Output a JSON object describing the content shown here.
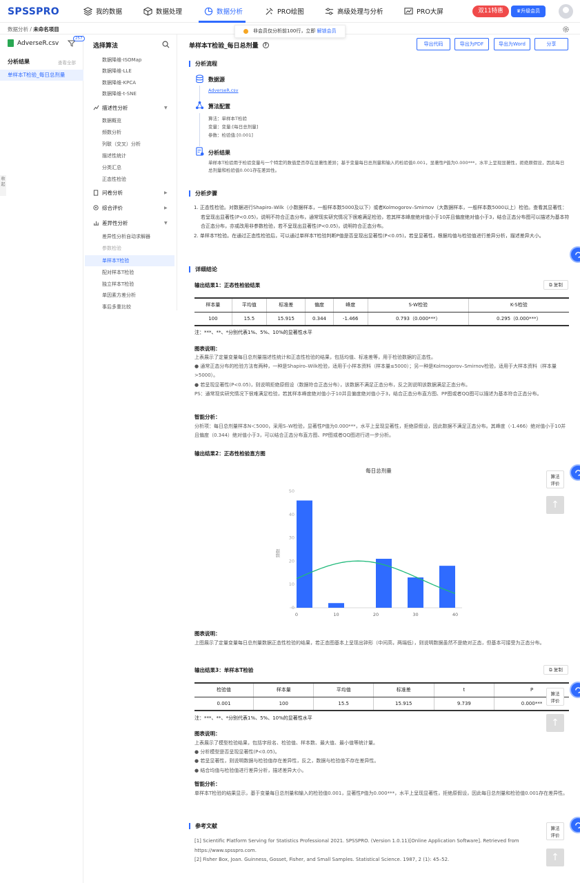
{
  "app": {
    "logo": "SPSSPRO"
  },
  "nav": [
    {
      "label": "我的数据",
      "icon": "layers-icon"
    },
    {
      "label": "数据处理",
      "icon": "cube-icon"
    },
    {
      "label": "数据分析",
      "icon": "pie-chart-icon",
      "active": true
    },
    {
      "label": "PRO绘图",
      "icon": "brush-icon"
    },
    {
      "label": "高级处理与分析",
      "icon": "sliders-icon"
    },
    {
      "label": "PRO大屏",
      "icon": "screen-chart-icon"
    }
  ],
  "header": {
    "promo": "双11特惠",
    "upgrade": "升级会员"
  },
  "breadcrumb": {
    "root": "数据分析 / ",
    "current": "未命名项目"
  },
  "notice": {
    "text": "非会员仅分析前100行，立即 ",
    "link": "解锁会员"
  },
  "left": {
    "file_name": "AdverseR.csv",
    "filter_badge": "257",
    "results_title": "分析结果",
    "view_all": "查看全部",
    "result_item": "单样本T检验_每日总剂量",
    "collapse": "收起"
  },
  "menu": {
    "title": "选择算法",
    "items": [
      {
        "type": "sub",
        "label": "数据降维-ISOMap"
      },
      {
        "type": "sub",
        "label": "数据降维-LLE"
      },
      {
        "type": "sub",
        "label": "数据降维-KPCA"
      },
      {
        "type": "sub",
        "label": "数据降维-t-SNE"
      },
      {
        "type": "group",
        "label": "描述性分析",
        "icon": "line-chart-icon",
        "arrow": "▼"
      },
      {
        "type": "sub",
        "label": "数据概览"
      },
      {
        "type": "sub",
        "label": "频数分析"
      },
      {
        "type": "sub",
        "label": "列联（交叉）分析"
      },
      {
        "type": "sub",
        "label": "描述性统计"
      },
      {
        "type": "sub",
        "label": "分类汇总"
      },
      {
        "type": "sub",
        "label": "正态性检验"
      },
      {
        "type": "group",
        "label": "问卷分析",
        "icon": "document-icon",
        "arrow": "▶"
      },
      {
        "type": "group",
        "label": "综合评价",
        "icon": "target-icon",
        "arrow": "▶"
      },
      {
        "type": "group",
        "label": "差异性分析",
        "icon": "bar-chart-icon",
        "arrow": "▼"
      },
      {
        "type": "sub",
        "label": "差异性分析自动求解器"
      },
      {
        "type": "sub",
        "label": "参数检验",
        "dim": true
      },
      {
        "type": "sub",
        "label": "单样本T检验",
        "selected": true
      },
      {
        "type": "sub",
        "label": "配对样本T检验"
      },
      {
        "type": "sub",
        "label": "独立样本T检验"
      },
      {
        "type": "sub",
        "label": "单因素方差分析"
      },
      {
        "type": "sub",
        "label": "事后多重比较"
      }
    ]
  },
  "main": {
    "title": "单样本T检验_每日总剂量",
    "buttons": [
      "导出代码",
      "导出为PDF",
      "导出为Word",
      "分享"
    ],
    "flow": {
      "title": "分析流程",
      "source_h": "数据源",
      "source_file": "AdverseR.csv",
      "algo_h": "算法配置",
      "algo_lines": [
        "算法：单样本T检验",
        "变量：变量:[每日总剂量]",
        "参数：检验值:[0.001]"
      ],
      "result_h": "分析结果",
      "result_text": "单样本T检验用于检验变量与一个特定的数值是否存在显著性差异；基于变量每日总剂量和输入的检验值0.001，显著性P值为0.000***，水平上呈现显著性，拒绝原假设，因此每日总剂量和检验值0.001存在差异性。"
    },
    "steps": {
      "title": "分析步骤",
      "items": [
        "1. 正态性检验。对数据进行Shapiro–Wilk（小数据样本，一般样本数5000及以下）或者Kolmogorov–Smirnov（大数据样本，一般样本数5000以上）检验。查看其显著性：若呈现出显著性(P<0.05)，说明不符合正态分布，通常现实研究情况下很难满足检验，若其样本峰度绝对值小于10并且偏度绝对值小于3，结合正态分布图可以描述为基本符合正态分布，亦或改用非参数检验，若不呈现出显著性(P<0.05)，说明符合正态分布。",
        "2. 单样本T检验。在通过正态性检验后，可以通过单样本T检验判断P值是否呈现出显著性(P<0.05)，若呈显著性，根据均值与检验值进行差异分析，描述差异大小。"
      ]
    },
    "detail": {
      "title": "详细结论",
      "copy": "复制",
      "r1_title": "输出结果1：正态性检验结果",
      "t1_headers": [
        "样本量",
        "平均值",
        "标准差",
        "偏度",
        "峰度",
        "S-W检验",
        "K-S检验"
      ],
      "t1_row": [
        "100",
        "15.5",
        "15.915",
        "0.344",
        "-1.466",
        "0.793（0.000***）",
        "0.295（0.000***）"
      ],
      "sig_note": "注：***、**、*分别代表1%、5%、10%的显著性水平",
      "desc_h": "图表说明：",
      "d1_lines": [
        "上表展示了定量变量每日总剂量描述性统计和正态性检验的结果，包括均值、标准差等，用于检验数据的正态性。",
        "● 通常正态分布的检验方法有两种，一种是Shapiro–Wilk检验，适用于小样本资料（样本量≤5000）；另一种是Kolmogorov–Smirnov检验，适用于大样本资料（样本量>5000）。",
        "● 若呈现显著性(P<0.05)，则说明拒绝原假设（数据符合正态分布），该数据不满足正态分布，反之则说明该数据满足正态分布。",
        "PS：通常现实研究情况下很难满足检验，若其样本峰度绝对值小于10并且偏度绝对值小于3，结合正态分布直方图、PP图或者QQ图可以描述为基本符合正态分布。"
      ],
      "smart_h": "智能分析：",
      "s1_text": "分析项：每日总剂量样本N＜5000，采用S–W检验，显著性P值为0.000***，水平上呈现显著性，拒绝原假设，因此数据不满足正态分布。其峰度（-1.466）绝对值小于10并且偏度（0.344）绝对值小于3，可以结合正态分布直方图、PP图或者QQ图进行进一步分析。",
      "r2_title": "输出结果2：正态性检验直方图",
      "d2_text": "上图展示了定量变量每日总剂量数据正态性检验的结果，若正态图基本上呈现出钟形（中间高，两端低），则说明数据虽然不是绝对正态，但基本可接受为正态分布。",
      "r3_title": "输出结果3：单样本T检验",
      "t3_headers": [
        "检验值",
        "样本量",
        "平均值",
        "标准差",
        "t",
        "P"
      ],
      "t3_row": [
        "0.001",
        "100",
        "15.5",
        "15.915",
        "9.739",
        "0.000***"
      ],
      "d3_lines": [
        "上表展示了模型检验结果，包括字段名、检验值、样本数、最大值、最小值等统计量。",
        "● 分析模型是否呈现显著性(P<0.05)。",
        "● 若呈显著性，则说明数据与检验值存在差异性，反之，数据与检验值不存在差异性。",
        "● 结合均值与检验值进行差异分析，描述差异大小。"
      ],
      "s3_text": "单样本T检验的结果显示，基于变量每日总剂量和输入的检验值0.001，显著性P值为0.000***，水平上呈现显著性，拒绝原假设，因此每日总剂量和检验值0.001存在差异性。"
    },
    "refs": {
      "title": "参考文献",
      "items": [
        "[1] Scientific Platform Serving for Statistics Professional 2021. SPSSPRO. (Version 1.0.11)[Online Application Software]. Retrieved from https://www.spsspro.com.",
        "[2] Fisher Box, Joan. Guinness, Gosset, Fisher, and Small Samples. Statistical Science. 1987, 2 (1): 45–52."
      ]
    },
    "side": {
      "eval": "算法\n评价",
      "top": "↑"
    }
  },
  "chart_data": {
    "type": "bar",
    "title": "每日总剂量",
    "ylabel": "频数",
    "xlim": [
      0,
      40
    ],
    "ylim": [
      0,
      50
    ],
    "xticks": [
      0,
      10,
      20,
      30,
      40
    ],
    "yticks": [
      0,
      10,
      20,
      30,
      40,
      50
    ],
    "bars": [
      {
        "x0": 0,
        "x1": 4,
        "count": 46
      },
      {
        "x0": 8,
        "x1": 12,
        "count": 2
      },
      {
        "x0": 20,
        "x1": 24,
        "count": 21
      },
      {
        "x0": 28,
        "x1": 32,
        "count": 13
      },
      {
        "x0": 36,
        "x1": 40,
        "count": 18
      }
    ],
    "normal_curve": {
      "mean": 15.5,
      "sd": 15.915,
      "n": 100,
      "bin_width": 8
    },
    "grid": false,
    "colors": {
      "bar": "#2f6bff",
      "curve": "#1fb97a"
    }
  }
}
